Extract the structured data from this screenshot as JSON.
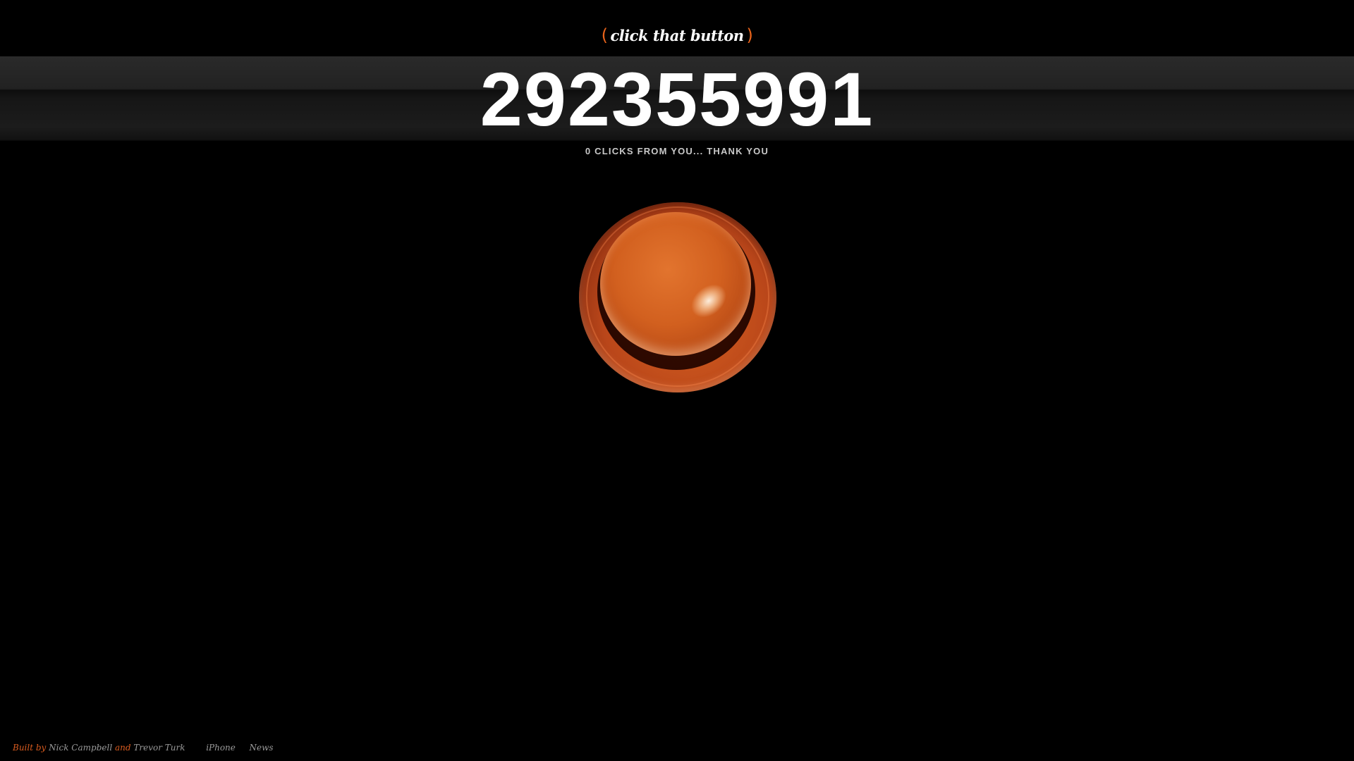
{
  "logo": {
    "open_paren": "(",
    "text": "click that button",
    "close_paren": ")"
  },
  "counter": {
    "value": "292355991"
  },
  "status": {
    "message": "0 CLICKS FROM YOU... THANK YOU"
  },
  "button": {
    "icon": "big-orange-push-button"
  },
  "footer": {
    "built_by": "Built by",
    "author_1": "Nick Campbell",
    "and": "and",
    "author_2": "Trevor Turk",
    "links": [
      "iPhone",
      "News"
    ]
  },
  "colors": {
    "background": "#000000",
    "accent": "#d95b1f",
    "button_orange": "#d2601f",
    "counter_text": "#ffffff"
  }
}
